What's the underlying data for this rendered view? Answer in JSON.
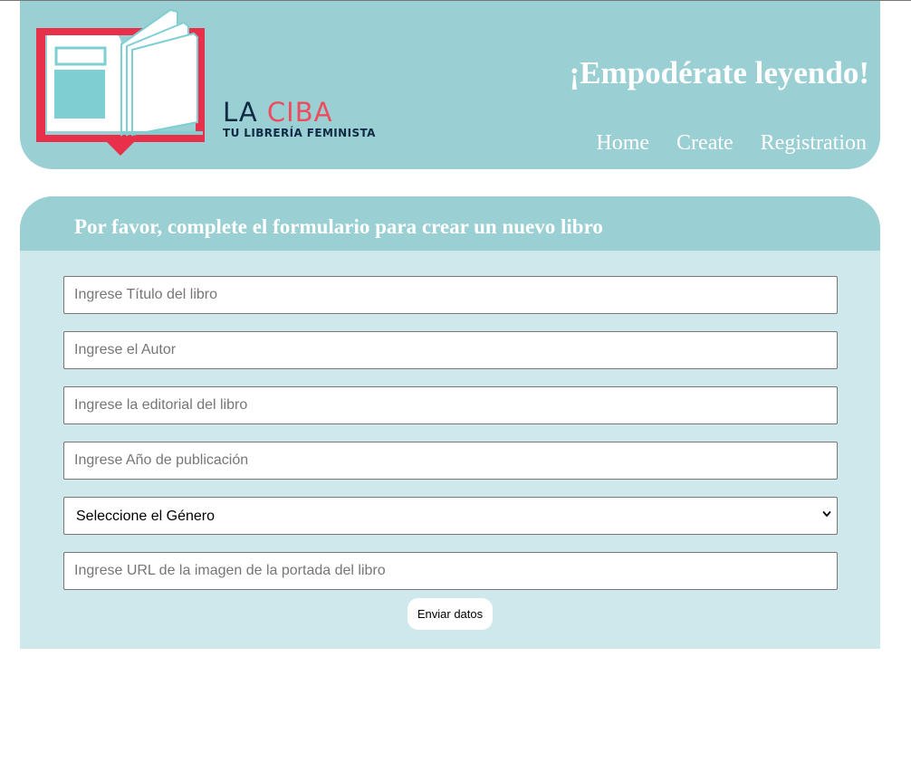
{
  "header": {
    "logo": {
      "name_part1": "LA",
      "name_part2": "CIBA",
      "tagline": "TU LIBRERÍA FEMINISTA"
    },
    "slogan": "¡Empodérate leyendo!",
    "nav": [
      {
        "label": "Home"
      },
      {
        "label": "Create"
      },
      {
        "label": "Registration"
      }
    ]
  },
  "form": {
    "title": "Por favor, complete el formulario para crear un nuevo libro",
    "fields": {
      "title": {
        "placeholder": "Ingrese Título del libro",
        "value": ""
      },
      "author": {
        "placeholder": "Ingrese el Autor",
        "value": ""
      },
      "publisher": {
        "placeholder": "Ingrese la editorial del libro",
        "value": ""
      },
      "year": {
        "placeholder": "Ingrese Año de publicación",
        "value": ""
      },
      "genre": {
        "selected": "Seleccione el Género"
      },
      "cover_url": {
        "placeholder": "Ingrese URL de la imagen de la portada del libro",
        "value": ""
      }
    },
    "submit_label": "Enviar datos"
  },
  "colors": {
    "header_bg": "#9acfd3",
    "form_bg": "#cfe8eb",
    "brand_dark": "#0f2a44",
    "brand_accent": "#ef4b5c",
    "logo_red": "#e8304a"
  },
  "icons": [
    "open-book-logo-icon",
    "chevron-down-icon"
  ]
}
